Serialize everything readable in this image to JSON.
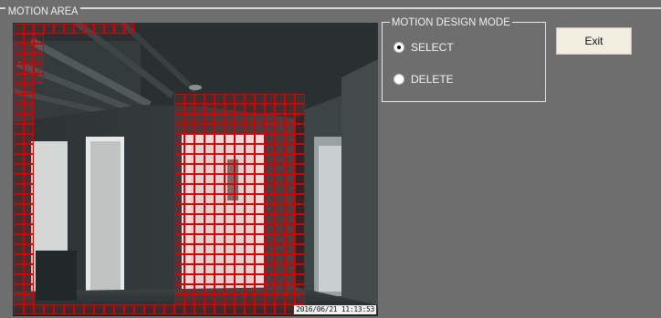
{
  "motion_area": {
    "title": "MOTION AREA",
    "timestamp": "2016/06/21 11:13:53",
    "grid_cols": 25,
    "grid_rows": 29,
    "selected_rects": [
      {
        "c0": 0,
        "c1": 11,
        "r0": 0,
        "r1": 0
      },
      {
        "c0": 0,
        "c1": 1,
        "r0": 0,
        "r1": 28
      },
      {
        "c0": 2,
        "c1": 2,
        "r0": 0,
        "r1": 5
      },
      {
        "c0": 0,
        "c1": 24,
        "r0": 28,
        "r1": 28
      },
      {
        "c0": 16,
        "c1": 28,
        "r0": 7,
        "r1": 28
      },
      {
        "c0": 2,
        "c1": 14,
        "r0": 28,
        "r1": 28
      }
    ]
  },
  "mode": {
    "title": "MOTION DESIGN MODE",
    "options": [
      {
        "label": "SELECT",
        "checked": true
      },
      {
        "label": "DELETE",
        "checked": false
      }
    ]
  },
  "exit_label": "Exit"
}
